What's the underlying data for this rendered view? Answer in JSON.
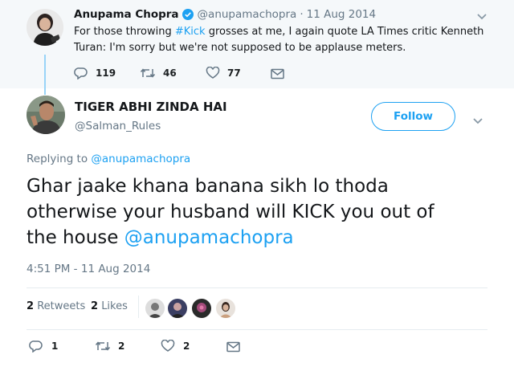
{
  "parent_tweet": {
    "name": "Anupama Chopra",
    "handle": "@anupamachopra",
    "separator": "·",
    "date": "11 Aug 2014",
    "text_before": "For those throwing ",
    "hashtag": "#Kick",
    "text_after": " grosses at me, I again quote LA Times critic Kenneth",
    "text_line2": "Turan: I'm sorry but we're not supposed to be applause meters.",
    "replies": "119",
    "retweets": "46",
    "likes": "77"
  },
  "tweet": {
    "name": "TIGER ABHI ZINDA HAI",
    "handle": "@Salman_Rules",
    "follow_label": "Follow",
    "replying_prefix": "Replying to",
    "replying_handle": "@anupamachopra",
    "text_line1": "Ghar jaake khana banana sikh lo thoda",
    "text_line2": "otherwise your husband will KICK you out of",
    "text_line3_prefix": "the house ",
    "text_mention": "@anupamachopra",
    "timestamp": "4:51 PM - 11 Aug 2014",
    "retweet_count": "2",
    "retweet_label": "Retweets",
    "like_count": "2",
    "like_label": "Likes",
    "reply_count": "1",
    "retweet_action_count": "2",
    "like_action_count": "2"
  },
  "colors": {
    "accent": "#1da1f2",
    "parent_bg": "#f5f8fa",
    "muted": "#657786"
  },
  "icons": [
    "verified-badge-icon",
    "chevron-down-icon",
    "reply-icon",
    "retweet-icon",
    "heart-icon",
    "mail-icon"
  ]
}
